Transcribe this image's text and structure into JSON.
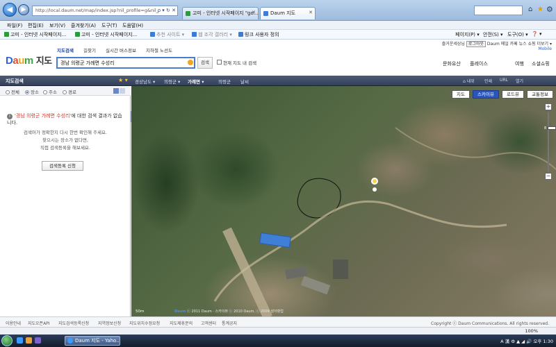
{
  "browser": {
    "address": "http://local.daum.net/map/index.jsp?nil_profile=g&nil_",
    "address_host": "daum.net",
    "tabs": [
      {
        "label": "고미 - 인터넷 시작페이지 \"go..."
      },
      {
        "label": "Daum 지도"
      }
    ],
    "menu": [
      "파일(F)",
      "편집(E)",
      "보기(V)",
      "즐겨찾기(A)",
      "도구(T)",
      "도움말(H)"
    ],
    "favorites": [
      {
        "label": "고미 - 인터넷 시작페이지..."
      },
      {
        "label": "고미 - 인터넷 시작페이지..."
      },
      {
        "label": "추천 사이트 ▾"
      },
      {
        "label": "웹 조각 갤러리 ▾"
      },
      {
        "label": "링크 사용자 정의"
      }
    ],
    "commands": [
      "페이지(P) ▾",
      "안전(S) ▾",
      "도구(O) ▾",
      "❓ ▾"
    ],
    "zoom_status": "100%"
  },
  "daum": {
    "logo": {
      "d": "D",
      "a": "a",
      "u": "u",
      "m": "m",
      "service": "지도"
    },
    "service_tabs": [
      "지도검색",
      "길찾기",
      "실시간 버스정보",
      "지하철 노선도"
    ],
    "search": {
      "value": "경남 의령군 가례면 수성리",
      "button": "검색",
      "within_map": "현재 지도 내 검색"
    },
    "top_links": {
      "user": "즐거운세상님",
      "login": "로그아웃",
      "brand": "Daum",
      "items": "메일  카페  뉴스  쇼핑  더보기 ▾"
    },
    "mobile": "Mobile",
    "categories": [
      "문화유산",
      "플레이스",
      "여행",
      "소셜쇼핑"
    ]
  },
  "toolbar": {
    "panel_title": "지도검색",
    "breadcrumbs": [
      "경상남도 ▾",
      "의령군 ▾",
      "가례면 ▾"
    ],
    "extra": [
      "의령군",
      "날씨"
    ],
    "right": [
      "⌂ 내위",
      "인쇄",
      "URL",
      "열기"
    ]
  },
  "left_panel": {
    "filters": [
      "전체",
      "장소",
      "주소",
      "경로"
    ],
    "no_result_query": "'경남 의령군 가례면 수성리'",
    "no_result_text": "에 대한 검색 결과가 없습니다.",
    "hint_lines": [
      "검색어가 정확한지 다시 한번 확인해 주세요.",
      "찾으시는 장소가 없다면,",
      "직접 검색등록을 해보세요."
    ],
    "register_button": "검색등록 신청"
  },
  "map": {
    "types": [
      "지도",
      "스카이뷰",
      "로드뷰",
      "교통정보"
    ],
    "active_type": "스카이뷰",
    "zoom_level": "8",
    "scale": "50m",
    "copyright_brand": "Daum",
    "copyright": "ⓒ 2011 Daum · 스카이뷰 ⓒ 2010 Daum, ⓒ 2009 삼아항업"
  },
  "footer": {
    "links": [
      "이용안내",
      "지도오픈API",
      "지도검색등록신청",
      "지역정보신청",
      "지도위치수정요청",
      "지도제휴문의",
      "고객센터",
      "통계공지"
    ],
    "copyright": "Copyright ⓒ Daum Communications. All rights reserved."
  },
  "taskbar": {
    "window": "Daum 지도 - Yaho...",
    "tray": "A 漢 ⚙ ▲ ◢ 🔊  오후 1:30"
  }
}
